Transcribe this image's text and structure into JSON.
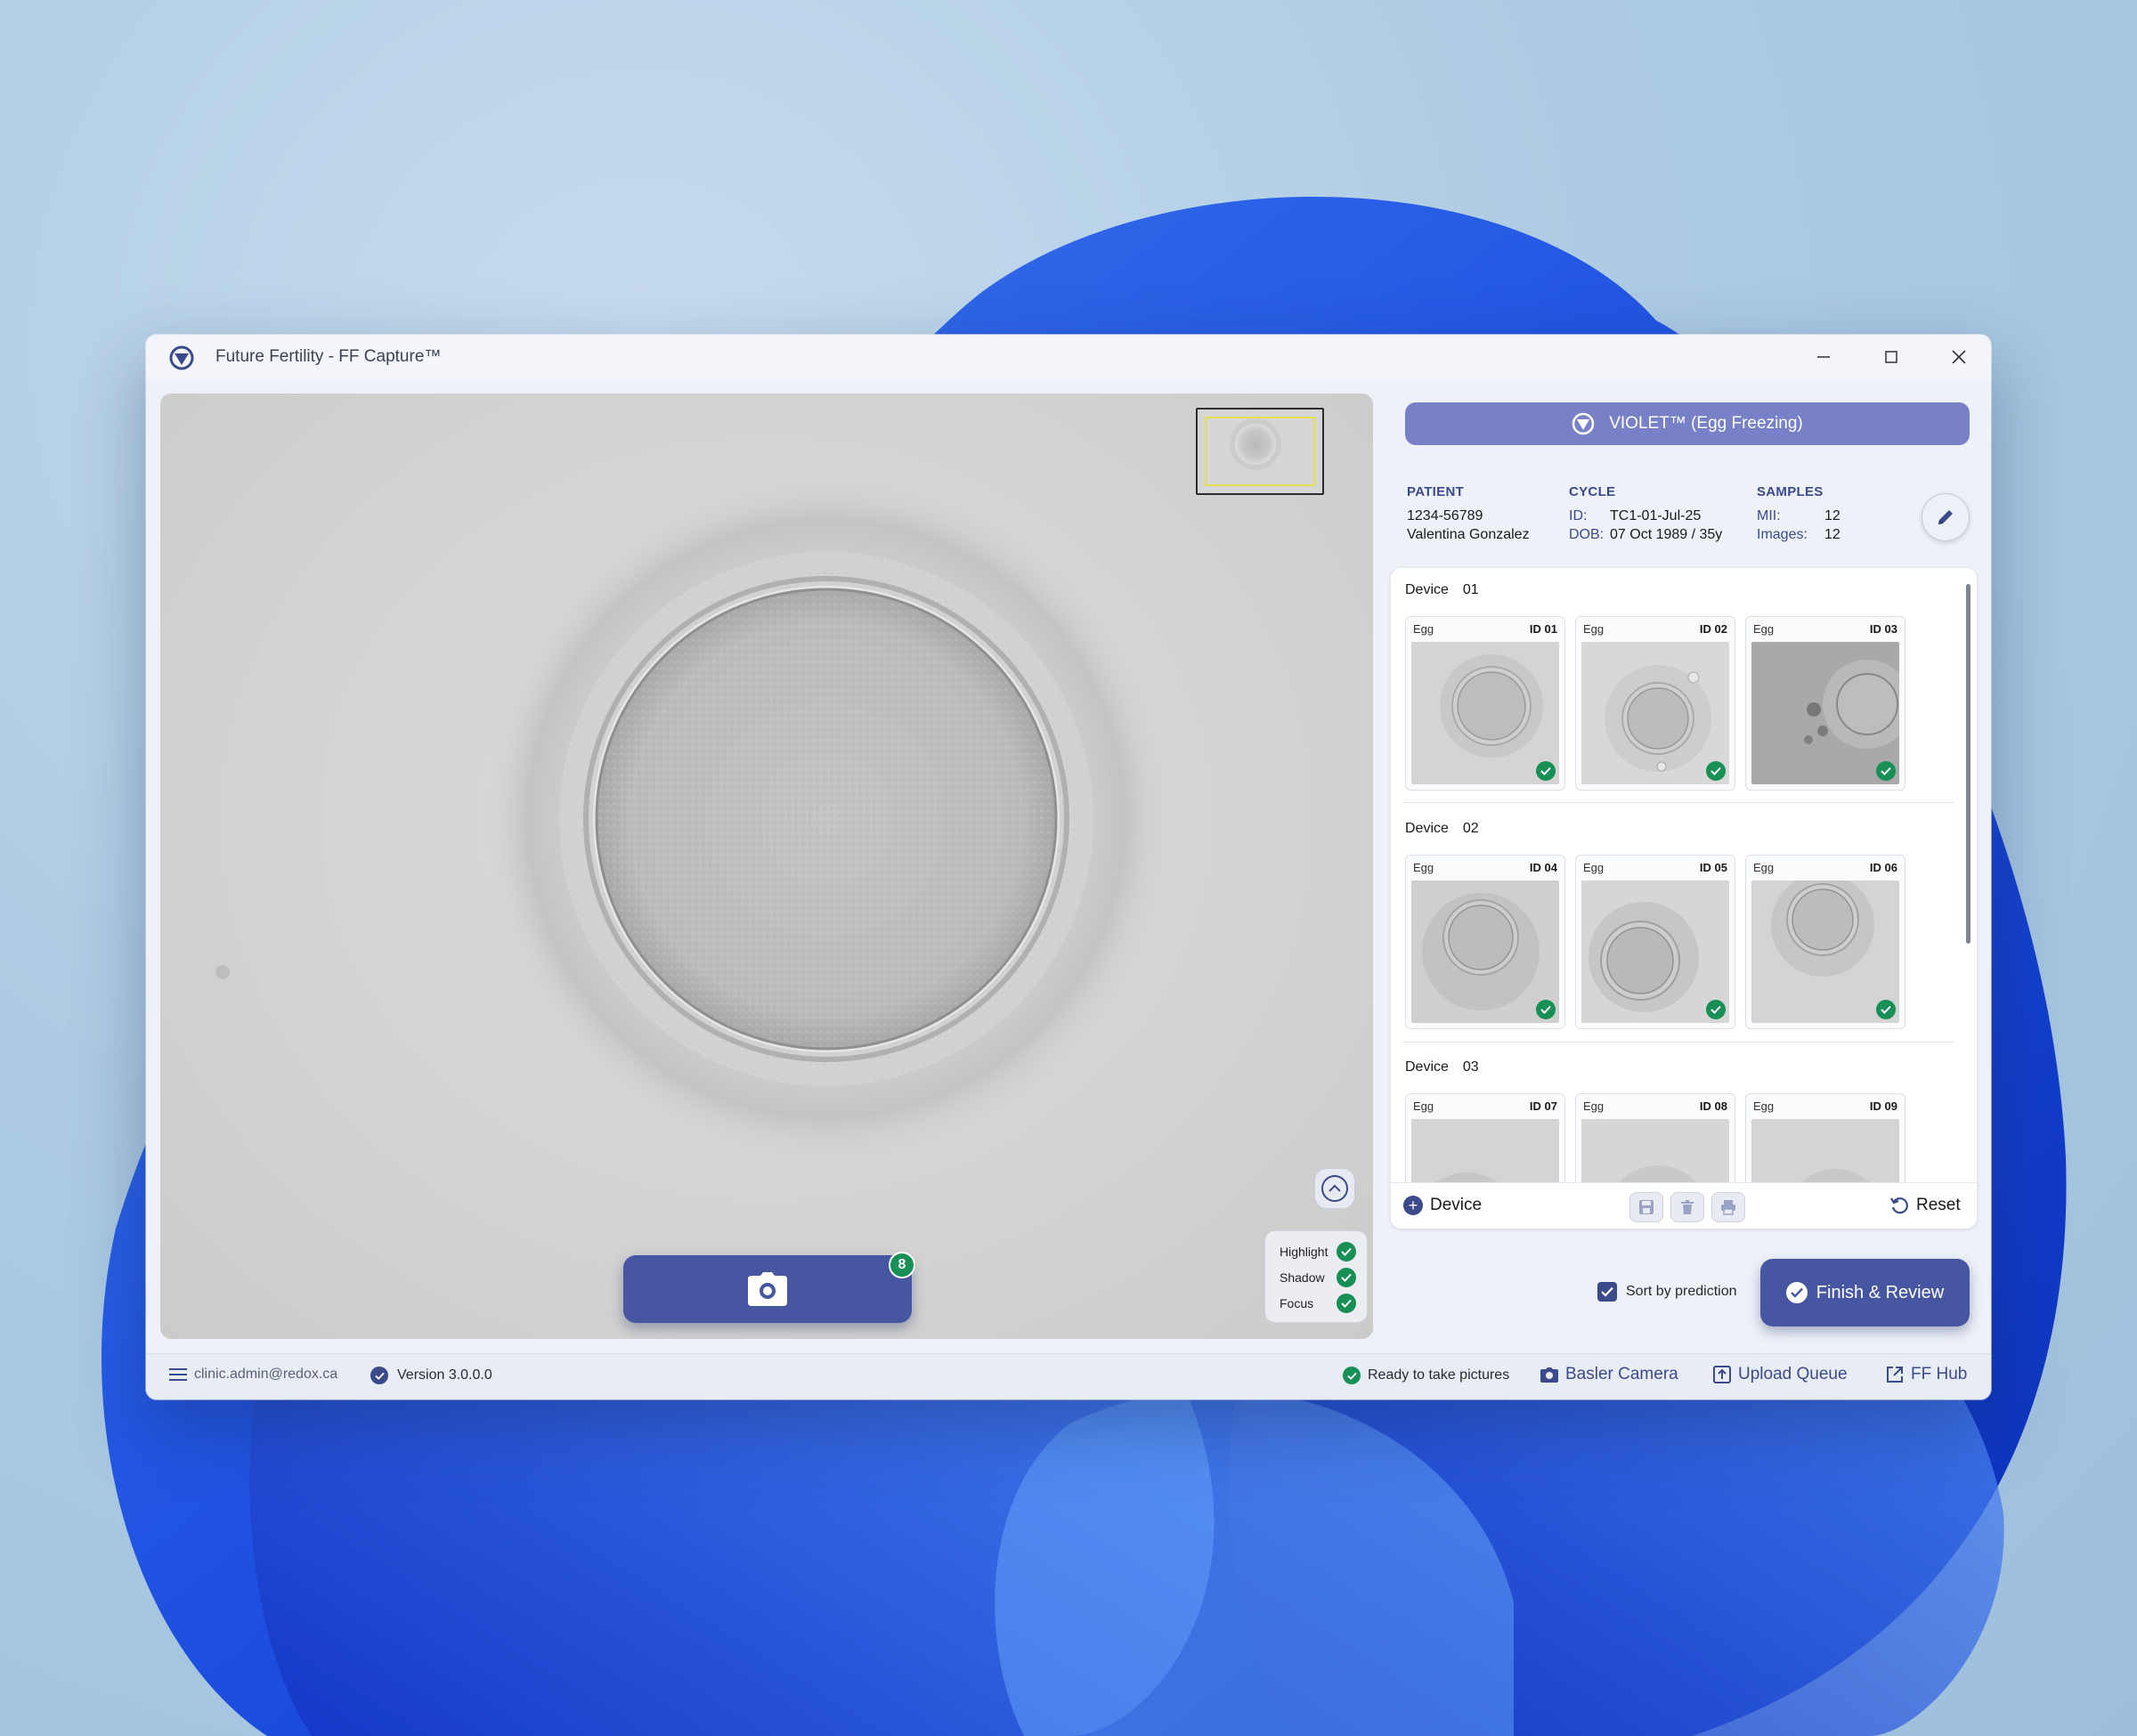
{
  "window": {
    "title": "Future Fertility - FF Capture™"
  },
  "viewer": {
    "capture_count": "8",
    "overlays": [
      {
        "label": "Highlight",
        "enabled": true
      },
      {
        "label": "Shadow",
        "enabled": true
      },
      {
        "label": "Focus",
        "enabled": true
      }
    ]
  },
  "mode": {
    "label": "VIOLET™ (Egg Freezing)"
  },
  "patient": {
    "heading": "PATIENT",
    "id": "1234-56789",
    "name": "Valentina Gonzalez"
  },
  "cycle": {
    "heading": "CYCLE",
    "id_label": "ID:",
    "id_value": "TC1-01-Jul-25",
    "dob_label": "DOB:",
    "dob_value": "07 Oct 1989 / 35y"
  },
  "samples": {
    "heading": "SAMPLES",
    "mii_label": "MII:",
    "mii_value": "12",
    "images_label": "Images:",
    "images_value": "12"
  },
  "devices": [
    {
      "label": "Device",
      "number": "01",
      "items": [
        {
          "type": "Egg",
          "id": "ID 01",
          "checked": true
        },
        {
          "type": "Egg",
          "id": "ID 02",
          "checked": true
        },
        {
          "type": "Egg",
          "id": "ID 03",
          "checked": true
        }
      ]
    },
    {
      "label": "Device",
      "number": "02",
      "items": [
        {
          "type": "Egg",
          "id": "ID 04",
          "checked": true
        },
        {
          "type": "Egg",
          "id": "ID 05",
          "checked": true
        },
        {
          "type": "Egg",
          "id": "ID 06",
          "checked": true
        }
      ]
    },
    {
      "label": "Device",
      "number": "03",
      "items": [
        {
          "type": "Egg",
          "id": "ID 07",
          "checked": false
        },
        {
          "type": "Egg",
          "id": "ID 08",
          "checked": false
        },
        {
          "type": "Egg",
          "id": "ID 09",
          "checked": false
        }
      ]
    }
  ],
  "footer": {
    "add_device_label": "Device",
    "reset_label": "Reset"
  },
  "actions": {
    "sort_label": "Sort by prediction",
    "sort_checked": true,
    "finish_label": "Finish & Review"
  },
  "statusbar": {
    "user": "clinic.admin@redox.ca",
    "version": "Version 3.0.0.0",
    "status": "Ready to take pictures",
    "camera": "Basler Camera",
    "upload": "Upload Queue",
    "hub": "FF Hub"
  },
  "colors": {
    "primary": "#4656a0",
    "mode_bar": "#7880c8",
    "success": "#178f55",
    "heading_blue": "#3a4a8c"
  }
}
